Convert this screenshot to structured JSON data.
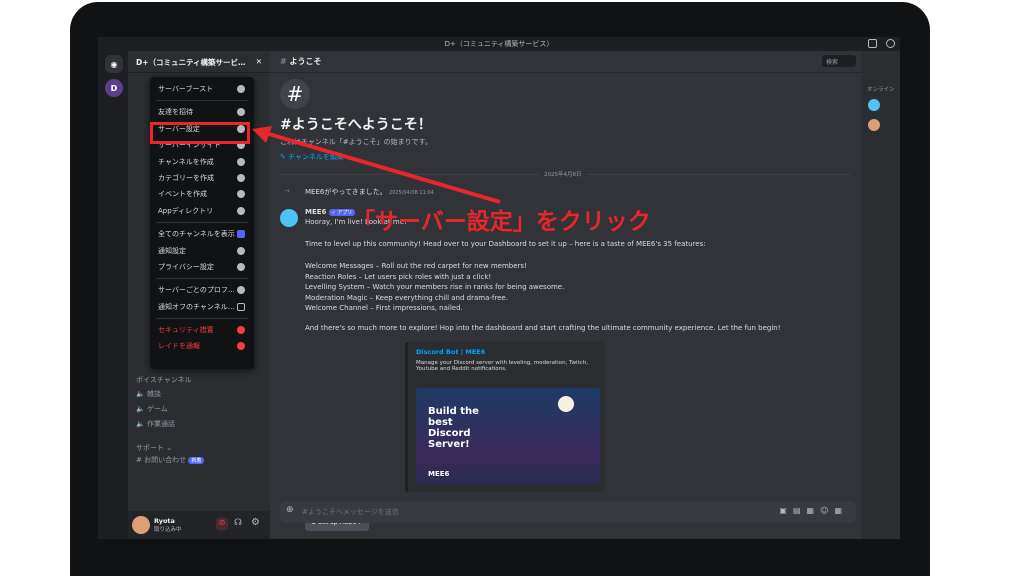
{
  "window_title": "D+（コミュニティ構築サービス）",
  "guild_initial": "D",
  "channels": {
    "server_name": "D+（コミュニティ構築サービ…",
    "categories": [
      {
        "label": "ボイスチャンネル",
        "items": [
          "雑談",
          "ゲーム",
          "作業通話"
        ]
      },
      {
        "label": "サポート",
        "items": [
          "お問い合わせ"
        ]
      }
    ],
    "new_badge": "新着"
  },
  "context_menu": {
    "items": [
      {
        "label": "サーバーブースト",
        "icon": "boost-icon",
        "danger": false
      },
      {
        "label": "友達を招待",
        "icon": "add-friend-icon",
        "danger": false
      },
      {
        "label": "サーバー設定",
        "icon": "gear-icon",
        "danger": false
      },
      {
        "label": "サーバーインサイト",
        "icon": "insights-icon",
        "danger": false
      },
      {
        "label": "チャンネルを作成",
        "icon": "plus-circle-icon",
        "danger": false
      },
      {
        "label": "カテゴリーを作成",
        "icon": "folder-plus-icon",
        "danger": false
      },
      {
        "label": "イベントを作成",
        "icon": "calendar-plus-icon",
        "danger": false
      },
      {
        "label": "Appディレクトリ",
        "icon": "grid-icon",
        "danger": false
      },
      {
        "label": "全てのチャンネルを表示",
        "icon": "checkbox-checked-icon",
        "danger": false
      },
      {
        "label": "通知設定",
        "icon": "bell-icon",
        "danger": false
      },
      {
        "label": "プライバシー設定",
        "icon": "shield-icon",
        "danger": false
      },
      {
        "label": "サーバーごとのプロフ…",
        "icon": "pencil-icon",
        "danger": false
      },
      {
        "label": "通知オフのチャンネル…",
        "icon": "checkbox-empty-icon",
        "danger": false
      },
      {
        "label": "セキュリティ措置",
        "icon": "lock-icon",
        "danger": true
      },
      {
        "label": "レイドを通報",
        "icon": "report-icon",
        "danger": true
      }
    ]
  },
  "annotation": "「サーバー設定」をクリック",
  "main": {
    "channel_name": "ようこそ",
    "welcome_title": "#ようこそへようこそ！",
    "welcome_sub": "これはチャンネル「#ようこそ」の始まりです。",
    "edit_channel": "チャンネルを編集",
    "date_divider": "2025年4月8日",
    "join_text": "MEE6がやってきました。",
    "join_time": "2025/04/08 11:04",
    "bot_name": "MEE6",
    "bot_tag": "✓ アプリ",
    "greeting": "Hooray, I'm live! Look at me!",
    "intro": "Time to level up this community! Head over to your Dashboard to set it up – here is a taste of MEE6's 35 features:",
    "dashboard_link": "your Dashboard",
    "features": [
      "Welcome Messages – Roll out the red carpet for new members!",
      "Reaction Roles – Let users pick roles with just a click!",
      "Levelling System – Watch your members rise in ranks for being awesome.",
      "Moderation Magic – Keep everything chill and drama-free.",
      "Welcome Channel – First impressions, nailed."
    ],
    "outro": "And there's so much more to explore! Hop into the dashboard and start crafting the ultimate community experience. Let the fun begin!",
    "embed": {
      "title": "Discord Bot | MEE6",
      "description": "Manage your Discord server with leveling, moderation, Twitch, Youtube and Reddit notifications.",
      "image_text": "Build the best Discord Server!",
      "image_brand": "MEE6"
    },
    "setup_button": "Set up MEE6",
    "input_placeholder": "#ようこそへメッセージを送信",
    "search_placeholder": "検索"
  },
  "members": {
    "header": "オンライン"
  },
  "user": {
    "name": "Ryota",
    "status": "取り込み中"
  },
  "colors": {
    "accent": "#5865f2",
    "highlight": "#e8262c",
    "bg": "#313338"
  }
}
